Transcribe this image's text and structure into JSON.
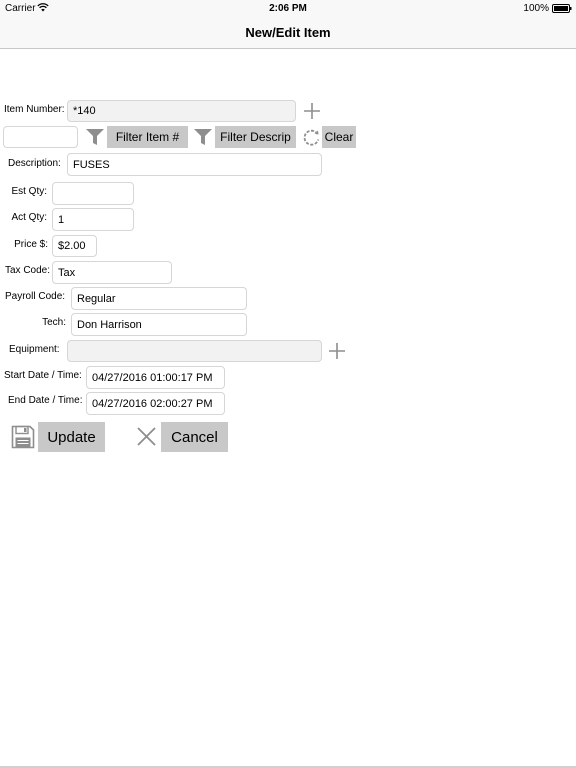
{
  "status_bar": {
    "carrier": "Carrier",
    "time": "2:06 PM",
    "battery": "100%"
  },
  "nav": {
    "title": "New/Edit Item"
  },
  "form": {
    "item_number": {
      "label": "Item Number:",
      "value": "*140"
    },
    "filter": {
      "search_value": "",
      "filter_item_label": "Filter Item #",
      "filter_descrip_label": "Filter Descrip",
      "clear_label": "Clear"
    },
    "description": {
      "label": "Description:",
      "value": "FUSES"
    },
    "est_qty": {
      "label": "Est Qty:",
      "value": ""
    },
    "act_qty": {
      "label": "Act Qty:",
      "value": "1"
    },
    "price": {
      "label": "Price $:",
      "value": "$2.00"
    },
    "tax_code": {
      "label": "Tax Code:",
      "value": "Tax"
    },
    "payroll_code": {
      "label": "Payroll Code:",
      "value": "Regular"
    },
    "tech": {
      "label": "Tech:",
      "value": "Don Harrison"
    },
    "equipment": {
      "label": "Equipment:",
      "value": ""
    },
    "start_datetime": {
      "label": "Start Date / Time:",
      "value": "04/27/2016 01:00:17 PM"
    },
    "end_datetime": {
      "label": "End Date / Time:",
      "value": "04/27/2016 02:00:27 PM"
    }
  },
  "actions": {
    "update_label": "Update",
    "cancel_label": "Cancel"
  },
  "icons": {
    "add": "plus-icon",
    "filter": "funnel-icon",
    "clear": "refresh-icon",
    "update": "floppy-disk-icon",
    "cancel": "close-icon"
  },
  "colors": {
    "button_bg": "#c8c8c8",
    "icon_gray": "#8e8e8e",
    "bar_bg": "#f8f8f8"
  }
}
